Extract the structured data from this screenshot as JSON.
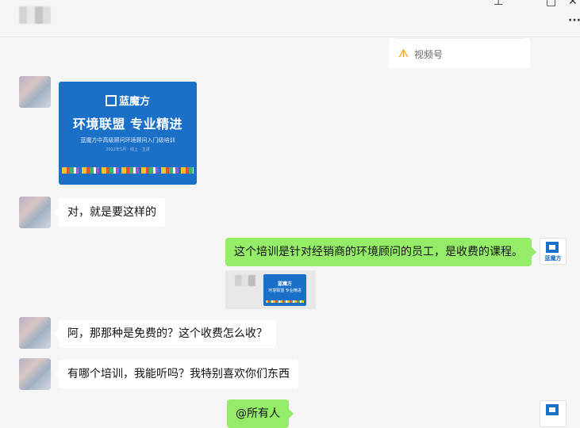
{
  "window": {
    "controls": {
      "pin": "⊥",
      "maximize": "□",
      "close": "✕"
    },
    "more": "···"
  },
  "channels_card": {
    "label": "视频号",
    "icon": "channels-icon"
  },
  "banner": {
    "brand": "蓝魔方",
    "headline": "环境联盟  专业精进",
    "subtitle": "蓝魔方中高级顾问环境顾问入门级培训",
    "tiny": "2022年5月 · 线上 · 主讲"
  },
  "messages": [
    {
      "side": "left",
      "text": "对，就是要这样的"
    },
    {
      "side": "right",
      "text": "这个培训是针对经销商的环境顾问的员工，是收费的课程。"
    },
    {
      "side": "left",
      "text": "阿，那那种是免费的？这个收费怎么收？"
    },
    {
      "side": "left",
      "text": "有哪个培训，我能听吗？我特别喜欢你们东西"
    },
    {
      "side": "right",
      "text": "@所有人"
    }
  ],
  "share_card": {
    "mini_brand": "蓝魔方",
    "mini_headline": "环境联盟 专业精进"
  },
  "self_avatar": {
    "label": "蓝魔方"
  },
  "colors": {
    "bubble_self": "#95ec69",
    "bubble_other": "#ffffff",
    "brand_blue": "#1a6fc7",
    "background": "#f5f5f5"
  }
}
